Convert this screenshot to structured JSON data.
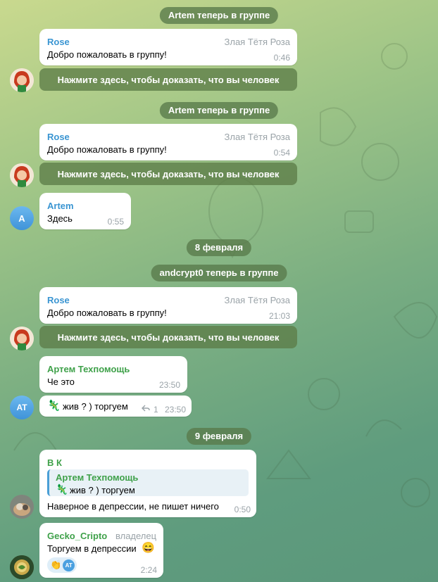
{
  "service": {
    "joined_1": "Artem теперь в группе",
    "joined_2": "Artem теперь в группе",
    "date_1": "8 февраля",
    "joined_3": "andcrypt0 теперь в группе",
    "date_2": "9 февраля"
  },
  "messages": {
    "rose_1": {
      "sender": "Rose",
      "badge": "Злая Тётя Роза",
      "text": "Добро пожаловать в группу!",
      "time": "0:46",
      "button": "Нажмите здесь, чтобы доказать, что вы человек"
    },
    "rose_2": {
      "sender": "Rose",
      "badge": "Злая Тётя Роза",
      "text": "Добро пожаловать в группу!",
      "time": "0:54",
      "button": "Нажмите здесь, чтобы доказать, что вы человек"
    },
    "artem": {
      "sender": "Artem",
      "text": "Здесь",
      "time": "0:55",
      "avatar_initials": "A"
    },
    "rose_3": {
      "sender": "Rose",
      "badge": "Злая Тётя Роза",
      "text": "Добро пожаловать в группу!",
      "time": "21:03",
      "button": "Нажмите здесь, чтобы доказать, что вы человек"
    },
    "tech_1": {
      "sender": "Артем Техпомощь",
      "text": "Че это",
      "time": "23:50",
      "avatar_initials": "AT"
    },
    "tech_2": {
      "text": "жив ? ) торгуем",
      "replies": "1",
      "time": "23:50"
    },
    "vk": {
      "sender": "В К",
      "quote_sender": "Артем Техпомощь",
      "quote_text": "жив ? ) торгуем",
      "text": "Наверное в депрессии, не пишет ничего",
      "time": "0:50"
    },
    "gecko": {
      "sender": "Gecko_Cripto",
      "badge": "владелец",
      "text": "Торгуем в депрессии",
      "reaction_avatar": "AT",
      "time": "2:24"
    }
  },
  "colors": {
    "rose_name": "#3a95d2",
    "artem_name": "#3a95d2",
    "tech_name": "#3fa14a",
    "vk_name": "#3fa14a",
    "gecko_name": "#3fa14a",
    "quote_accent": "#4a9fd6"
  },
  "icons": [
    "lizard-emoji-icon",
    "reply-arrow-icon",
    "grin-emoji-icon",
    "clap-emoji-icon"
  ]
}
